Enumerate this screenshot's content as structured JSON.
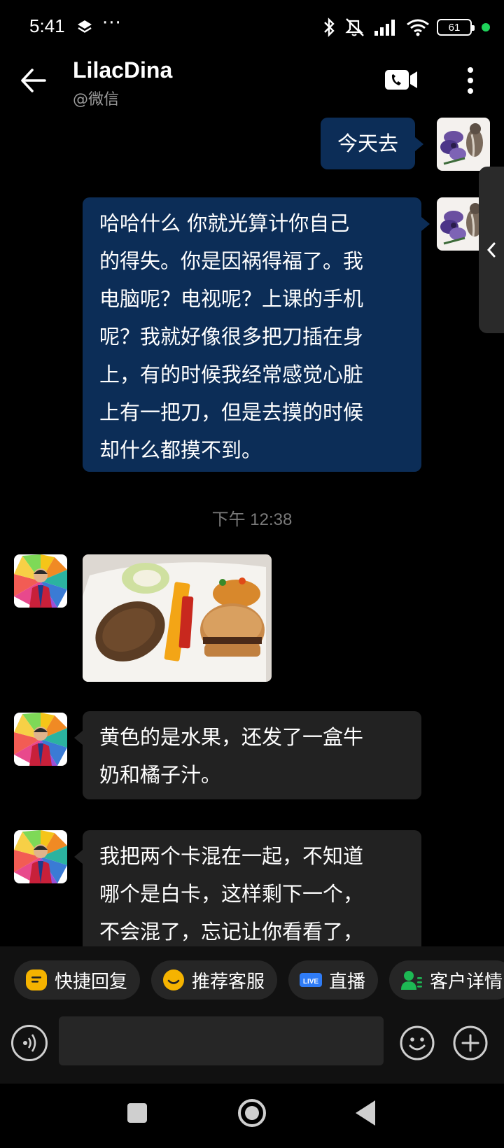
{
  "status_bar": {
    "time": "5:41",
    "dots": "···",
    "battery": "61",
    "icons": [
      "layers-icon",
      "bluetooth-icon",
      "mute-icon",
      "signal-icon",
      "wifi-icon",
      "battery-icon"
    ]
  },
  "header": {
    "name": "LilacDina",
    "subtitle": "@微信",
    "icons": [
      "back-arrow-icon",
      "video-call-icon",
      "more-vert-icon"
    ]
  },
  "messages": [
    {
      "side": "out",
      "text": "今天去"
    },
    {
      "side": "out",
      "lines": [
        "哈哈什么 你就光算计你自己",
        "的得失。你是因祸得福了。我",
        "电脑呢？电视呢？上课的手机",
        "呢？我就好像很多把刀插在身",
        "上，有的时候我经常感觉心脏",
        "上有一把刀，但是去摸的时候",
        "却什么都摸不到。"
      ]
    },
    {
      "side": "time",
      "text": "下午 12:38"
    },
    {
      "side": "in",
      "type": "image"
    },
    {
      "side": "in",
      "lines": [
        "黄色的是水果，还发了一盒牛",
        "奶和橘子汁。"
      ]
    },
    {
      "side": "in",
      "lines": [
        "我把两个卡混在一起，不知道",
        "哪个是白卡，这样剩下一个，",
        "不会混了，忘记让你看看了，"
      ]
    }
  ],
  "quick_actions": [
    {
      "label": "快捷回复",
      "icon": "quick-reply-icon",
      "color": "#f5b300"
    },
    {
      "label": "推荐客服",
      "icon": "recommend-service-icon",
      "color": "#f5b300"
    },
    {
      "label": "直播",
      "icon": "live-icon",
      "icon_text": "LIVE",
      "color": "#2f7cf6"
    },
    {
      "label": "客户详情",
      "icon": "customer-detail-icon",
      "color": "#1db954"
    }
  ],
  "input": {
    "placeholder": "",
    "value": ""
  },
  "colors": {
    "out_bubble": "#0c2d57",
    "in_bubble": "#222222",
    "background": "#000000"
  }
}
